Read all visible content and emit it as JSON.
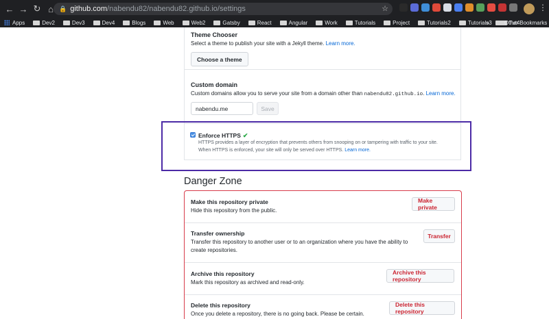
{
  "browser": {
    "url_host": "github.com",
    "url_path": "/nabendu82/nabendu82.github.io/settings",
    "bookmarks": [
      "Apps",
      "Dev2",
      "Dev3",
      "Dev4",
      "Blogs",
      "Web",
      "Web2",
      "Gatsby",
      "React",
      "Angular",
      "Work",
      "Tutorials",
      "Project",
      "Tutorials2",
      "Tutorials3",
      "Tut4"
    ],
    "more": "»",
    "other_bookmarks": "Other Bookmarks",
    "extension_colors": [
      "#2a2a2a",
      "#5b6cd8",
      "#3f8ed8",
      "#e04a3a",
      "#d9dee6",
      "#4a7ff0",
      "#e08e2b",
      "#57a05b",
      "#e54d42",
      "#c53434",
      "#777777"
    ]
  },
  "theme": {
    "title": "Theme Chooser",
    "desc": "Select a theme to publish your site with a Jekyll theme.",
    "learn_more": "Learn more.",
    "button": "Choose a theme"
  },
  "domain": {
    "title": "Custom domain",
    "desc_pre": "Custom domains allow you to serve your site from a domain other than",
    "desc_code": "nabendu82.github.io",
    "desc_post": ".",
    "learn_more": "Learn more.",
    "value": "nabendu.me",
    "save": "Save"
  },
  "https": {
    "title": "Enforce HTTPS",
    "check": "✔",
    "line1": "HTTPS provides a layer of encryption that prevents others from snooping on or tampering with traffic to your site.",
    "line2": "When HTTPS is enforced, your site will only be served over HTTPS.",
    "learn_more": "Learn more.",
    "checked": true
  },
  "danger": {
    "heading": "Danger Zone",
    "private_title": "Make this repository private",
    "private_desc": "Hide this repository from the public.",
    "private_btn": "Make private",
    "transfer_title": "Transfer ownership",
    "transfer_desc1": "Transfer this repository to another user or to an organization where you have the ability to",
    "transfer_desc2": "create repositories.",
    "transfer_btn": "Transfer",
    "archive_title": "Archive this repository",
    "archive_desc": "Mark this repository as archived and read-only.",
    "archive_btn": "Archive this repository",
    "delete_title": "Delete this repository",
    "delete_desc": "Once you delete a repository, there is no going back. Please be certain.",
    "delete_btn": "Delete this repository"
  }
}
